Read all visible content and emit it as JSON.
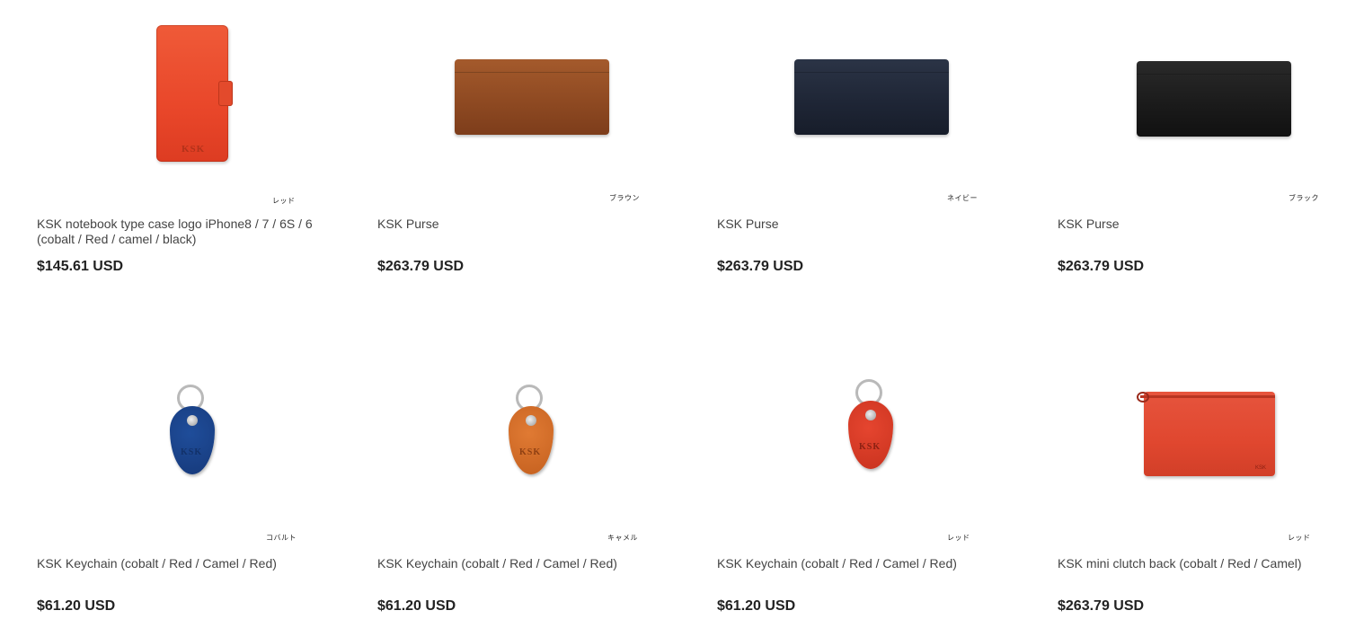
{
  "products": [
    {
      "title": "KSK notebook type case logo iPhone8 / 7 / 6S / 6 (cobalt / Red / camel / black)",
      "price": "$145.61 USD",
      "tag": "レッド",
      "image": "red-phone-case",
      "logo": "KSK"
    },
    {
      "title": "KSK Purse",
      "price": "$263.79 USD",
      "tag": "ブラウン",
      "image": "brown-long-wallet"
    },
    {
      "title": "KSK Purse",
      "price": "$263.79 USD",
      "tag": "ネイビー",
      "image": "navy-long-wallet"
    },
    {
      "title": "KSK Purse",
      "price": "$263.79 USD",
      "tag": "ブラック",
      "image": "black-long-wallet"
    },
    {
      "title": "KSK Keychain (cobalt / Red / Camel / Red)",
      "price": "$61.20 USD",
      "tag": "コバルト",
      "image": "cobalt-keychain",
      "logo": "KSK"
    },
    {
      "title": "KSK Keychain (cobalt / Red / Camel / Red)",
      "price": "$61.20 USD",
      "tag": "キャメル",
      "image": "camel-keychain",
      "logo": "KSK"
    },
    {
      "title": "KSK Keychain (cobalt / Red / Camel / Red)",
      "price": "$61.20 USD",
      "tag": "レッド",
      "image": "red-keychain",
      "logo": "KSK"
    },
    {
      "title": "KSK mini clutch back (cobalt / Red / Camel)",
      "price": "$263.79 USD",
      "tag": "レッド",
      "image": "red-mini-clutch",
      "logo": "KSK"
    }
  ]
}
